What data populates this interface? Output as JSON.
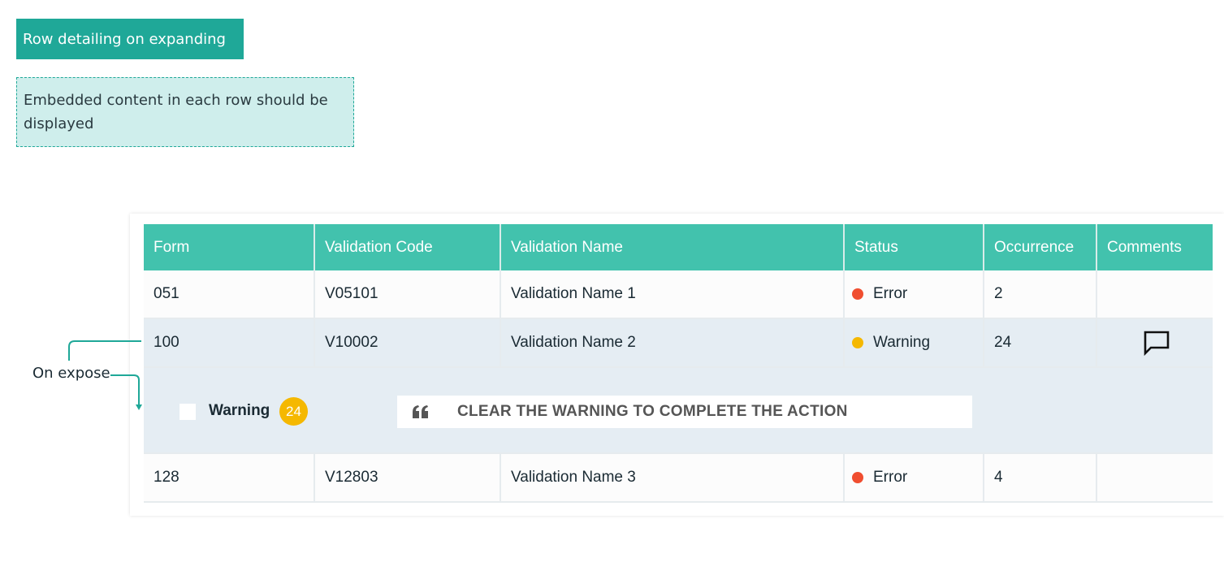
{
  "header": {
    "tag_label": "Row detailing on expanding",
    "note_text": "Embedded content in each row should be displayed"
  },
  "annotation": {
    "label": "On expose"
  },
  "table": {
    "columns": [
      "Form",
      "Validation Code",
      "Validation Name",
      "Status",
      "Occurrence",
      "Comments"
    ],
    "rows": [
      {
        "form": "051",
        "code": "V05101",
        "name": "Validation Name 1",
        "status": "Error",
        "status_color": "#f04e30",
        "occurrence": "2",
        "comment": false
      },
      {
        "form": "100",
        "code": "V10002",
        "name": "Validation Name 2",
        "status": "Warning",
        "status_color": "#f5b800",
        "occurrence": "24",
        "comment": true,
        "comment_icon": "comment-icon"
      },
      {
        "form": "128",
        "code": "V12803",
        "name": "Validation Name 3",
        "status": "Error",
        "status_color": "#f04e30",
        "occurrence": "4",
        "comment": false
      }
    ],
    "expanded": {
      "checkbox_label": "Warning",
      "badge_count": "24",
      "quote_icon": "quote-icon",
      "message": "CLEAR THE WARNING TO COMPLETE THE ACTION"
    }
  },
  "colors": {
    "accent": "#1fa898",
    "header_bg": "#42c2ad",
    "error": "#f04e30",
    "warning": "#f5b800",
    "selected_row": "#e5edf3"
  }
}
